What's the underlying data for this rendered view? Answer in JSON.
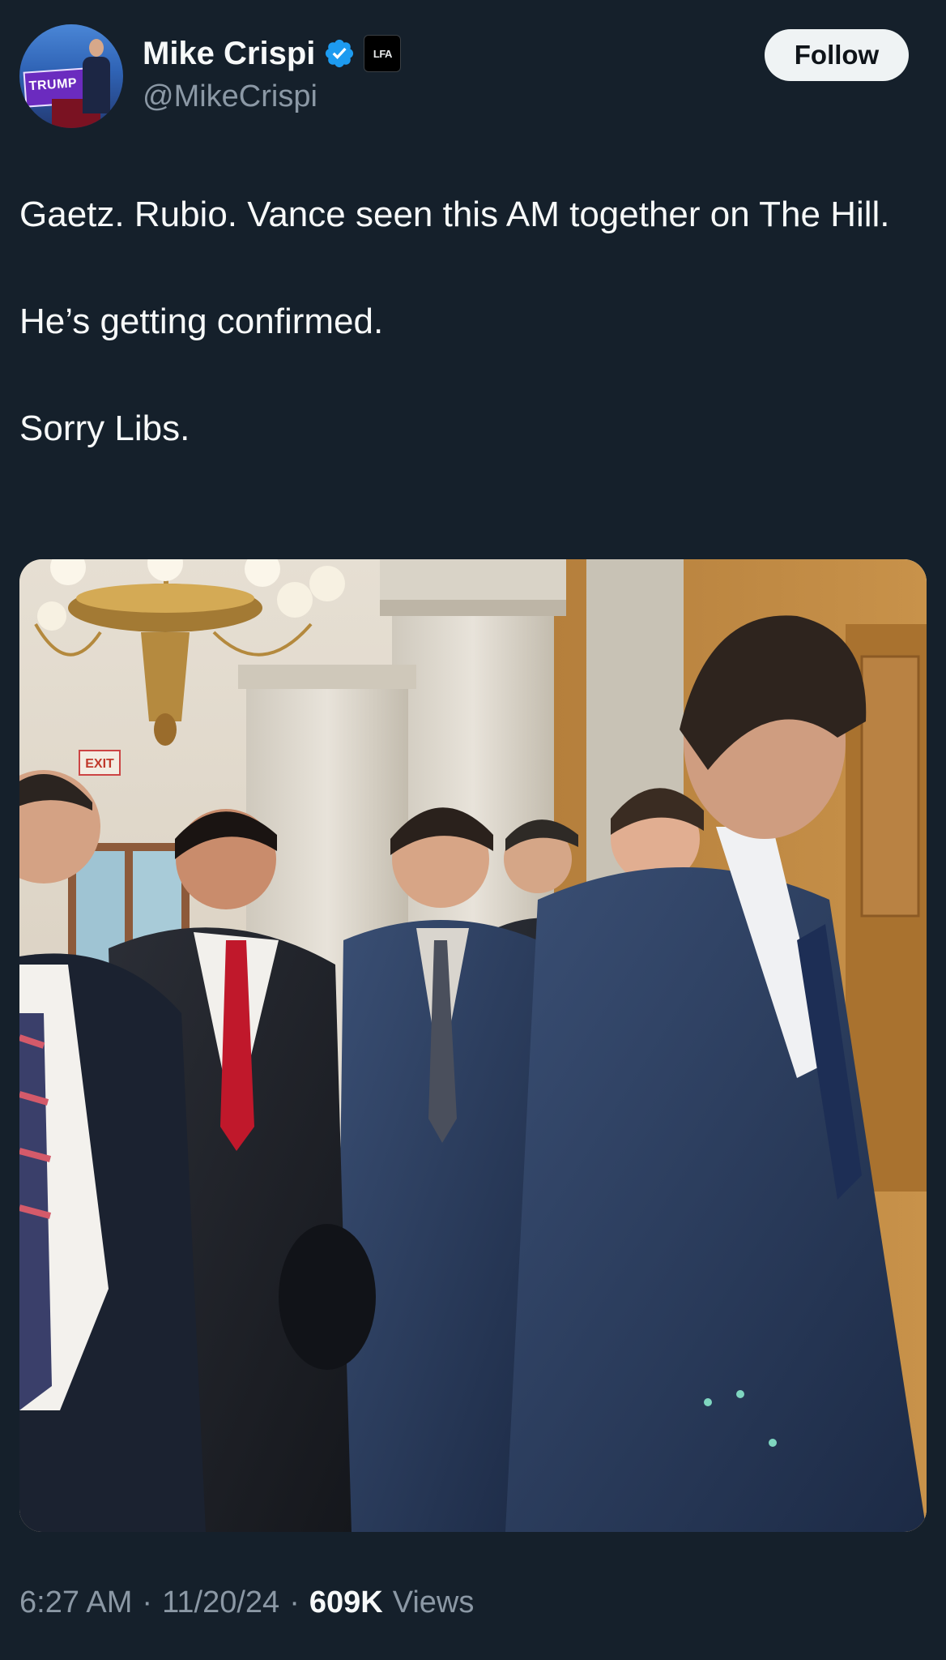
{
  "author": {
    "display_name": "Mike Crispi",
    "handle": "@MikeCrispi",
    "verified": true,
    "affiliate_badge_text": "LFA",
    "avatar_sign_text": "TRUMP"
  },
  "follow_button_label": "Follow",
  "tweet": {
    "lines": [
      "Gaetz. Rubio. Vance seen this AM together on The Hill.",
      "He’s getting confirmed.",
      "Sorry Libs."
    ]
  },
  "media": {
    "exit_sign_text": "EXIT"
  },
  "meta": {
    "time": "6:27 AM",
    "date": "11/20/24",
    "separator": "·",
    "views_count": "609K",
    "views_label": "Views"
  },
  "colors": {
    "background": "#15202b",
    "text_primary": "#f7f9f9",
    "text_secondary": "#8b98a5",
    "verified_blue": "#1d9bf0",
    "follow_bg": "#eff3f4"
  }
}
